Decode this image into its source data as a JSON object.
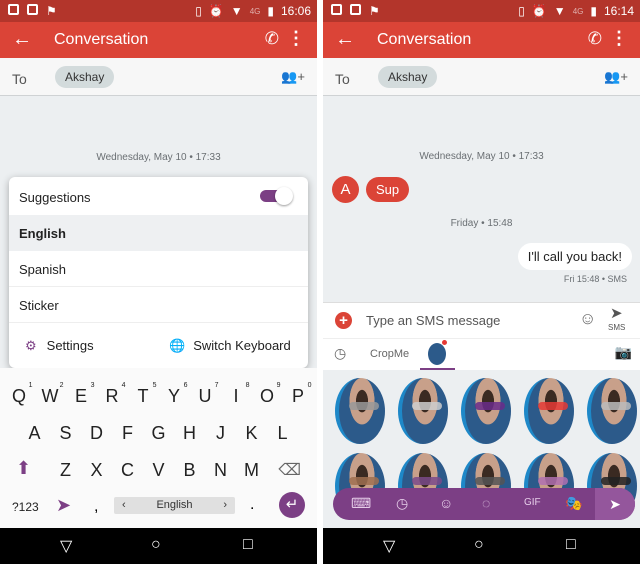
{
  "left": {
    "status_time": "16:06",
    "network": "4G",
    "title": "Conversation",
    "to_label": "To",
    "recipient": "Akshay",
    "timestamp": "Wednesday, May 10 • 17:33",
    "popup": {
      "suggestions": "Suggestions",
      "suggestions_on": true,
      "languages": [
        "English",
        "Spanish",
        "Sticker"
      ],
      "selected": "English",
      "settings": "Settings",
      "switch_keyboard": "Switch Keyboard"
    },
    "keyboard": {
      "row1": [
        "Q",
        "W",
        "E",
        "R",
        "T",
        "Y",
        "U",
        "I",
        "O",
        "P"
      ],
      "row1_hints": [
        "1",
        "2",
        "3",
        "4",
        "5",
        "6",
        "7",
        "8",
        "9",
        "0"
      ],
      "row2": [
        "A",
        "S",
        "D",
        "F",
        "G",
        "H",
        "J",
        "K",
        "L"
      ],
      "row3": [
        "Z",
        "X",
        "C",
        "V",
        "B",
        "N",
        "M"
      ],
      "symbols": "?123",
      "comma": ",",
      "space": "English",
      "period": ".",
      "space_prev": "‹",
      "space_next": "›"
    }
  },
  "right": {
    "status_time": "16:14",
    "network": "4G",
    "title": "Conversation",
    "to_label": "To",
    "recipient": "Akshay",
    "timestamp1": "Wednesday, May 10 • 17:33",
    "avatar_letter": "A",
    "incoming": "Sup",
    "timestamp2": "Friday • 15:48",
    "outgoing": "I'll call you back!",
    "outgoing_meta": "Fri 15:48 • SMS",
    "composer_placeholder": "Type an SMS message",
    "send_label": "SMS",
    "tab_label": "CropMe"
  },
  "colors": {
    "app_bar": "#db4437",
    "status_bar": "#b3352b",
    "accent_purple": "#7c3f85"
  }
}
